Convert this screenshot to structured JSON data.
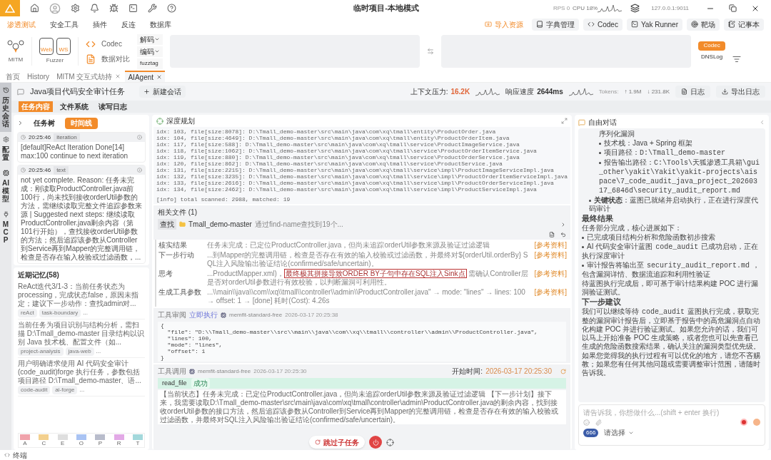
{
  "titlebar": {
    "title": "临时项目-本地模式",
    "rps": "RPS 0",
    "cpu": "CPU 18%",
    "address": "127.0.0.1:9011"
  },
  "menu": [
    {
      "label": "渗透测试",
      "selected": true
    },
    {
      "label": "安全工具",
      "selected": false
    },
    {
      "label": "插件",
      "selected": false
    },
    {
      "label": "反连",
      "selected": false
    },
    {
      "label": "数据库",
      "selected": false
    }
  ],
  "menu_actions": [
    "导入资源",
    "字典管理",
    "Codec",
    "Yak Runner",
    "靶场",
    "记事本"
  ],
  "toolbar": {
    "mitm": "MITM",
    "fuzzer": "Fuzzer",
    "web": "Web",
    "ws": "WS",
    "codec": "Codec",
    "compare": "数据对比",
    "decode": "解码",
    "encode": "编码",
    "fuzztag": "fuzztag",
    "side_buttons": [
      {
        "label": "Codec",
        "selected": true
      },
      {
        "label": "DNSLog",
        "selected": false
      }
    ]
  },
  "page_tabs": [
    {
      "label": "首页",
      "selected": false,
      "closable": false
    },
    {
      "label": "History",
      "selected": false,
      "closable": false
    },
    {
      "label": "MITM 交互式劫持",
      "selected": false,
      "closable": true
    },
    {
      "label": "AIAgent",
      "selected": true,
      "closable": true
    }
  ],
  "side_strip": [
    {
      "label": "历史会话",
      "selected": true
    },
    {
      "label": "配置",
      "selected": false
    },
    {
      "label": "AI模型",
      "selected": false
    },
    {
      "label": "MCP",
      "selected": false
    }
  ],
  "header": {
    "title": "Java项目代码安全审计任务",
    "new_session": "新建会话",
    "pressure_label": "上下文压力:",
    "pressure": "16.2K",
    "speed_label": "响应速度",
    "speed": "2644ms",
    "tokens_label": "Tokens:",
    "tokens_up": "↑ 1.9M",
    "tokens_down": "↓ 231.8K",
    "log": "日志",
    "export": "导出日志"
  },
  "content_tabs": [
    {
      "label": "任务内容",
      "selected": true
    },
    {
      "label": "文件系统",
      "selected": false
    },
    {
      "label": "读写日志",
      "selected": false
    }
  ],
  "left": {
    "view_tabs": [
      {
        "label": "任务树",
        "selected": false
      },
      {
        "label": "时间线",
        "selected": true
      }
    ],
    "events": [
      {
        "time": "20:25:46",
        "tag": "iteration",
        "text": "[default]ReAct Iteration Done[14] max:100 continue to next iteration"
      },
      {
        "time": "20:25:46",
        "tag": "text",
        "text": "not yet complete. Reason: 任务未完成：刚读取ProductController.java前100行，尚未找到接收orderUtil参数的方法，需继续读取完整文件追踪参数来源 | Suggested next steps: 继续读取ProductController.java剩余内容（第101行开始），查找接收orderUtil参数的方法；然后追踪该参数从Controller到Service再到Mapper的完整调用链，检查是否存在输入校验或过滤函数，..."
      }
    ],
    "memory_title": "近期记忆(58)",
    "memories": [
      {
        "text": "ReAct迭代3/1-3：当前任务状态为processing，完成状态false，原因未指定；建议下一步动作：查找admin对...",
        "tags": [
          "reAct",
          "task-boundary"
        ]
      },
      {
        "text": "当前任务为项目识别与结构分析，需扫描 D:\\Tmall_demo-master 目录结构以识别 Java 技术栈、配置文件（如...",
        "tags": [
          "project-analysis",
          "java-web"
        ]
      },
      {
        "text": "用户明确请求使用 AI 代码安全审计 (code_audit)forge 执行任务，参数包括项目路径 D:\\Tmall_demo-master、语...",
        "tags": [
          "code-audit",
          "ai-forge"
        ]
      }
    ],
    "more": "...",
    "legend": [
      {
        "letter": "A",
        "color": "#f0a3ab"
      },
      {
        "letter": "C",
        "color": "#f3d08e"
      },
      {
        "letter": "E",
        "color": "#dedede"
      },
      {
        "letter": "O",
        "color": "#a9c3f3"
      },
      {
        "letter": "P",
        "color": "#b8bccb"
      },
      {
        "letter": "R",
        "color": "#e2a9e6"
      },
      {
        "letter": "T",
        "color": "#a3d8db"
      }
    ]
  },
  "plan": {
    "title": "深度规划",
    "lines": [
      "idx: 103, file[size:8078]: D:\\Tmall_demo-master\\src\\main\\java\\com\\xq\\tmall\\entity\\ProductOrder.java",
      "idx: 104, file[size:4649]: D:\\Tmall_demo-master\\src\\main\\java\\com\\xq\\tmall\\entity\\ProductOrderItem.java",
      "idx: 117, file[size:588]: D:\\Tmall_demo-master\\src\\main\\java\\com\\xq\\tmall\\service\\ProductImageService.java",
      "idx: 118, file[size:1062]: D:\\Tmall_demo-master\\src\\main\\java\\com\\xq\\tmall\\service\\ProductOrderItemService.java",
      "idx: 119, file[size:880]: D:\\Tmall_demo-master\\src\\main\\java\\com\\xq\\tmall\\service\\ProductOrderService.java",
      "idx: 120, file[size:862]: D:\\Tmall_demo-master\\src\\main\\java\\com\\xq\\tmall\\service\\ProductService.java",
      "idx: 131, file[size:2215]: D:\\Tmall_demo-master\\src\\main\\java\\com\\xq\\tmall\\service\\impl\\ProductImageServiceImpl.java",
      "idx: 132, file[size:3235]: D:\\Tmall_demo-master\\src\\main\\java\\com\\xq\\tmall\\service\\impl\\ProductOrderItemServiceImpl.java",
      "idx: 133, file[size:2616]: D:\\Tmall_demo-master\\src\\main\\java\\com\\xq\\tmall\\service\\impl\\ProductOrderServiceImpl.java",
      "idx: 134, file[size:2462]: D:\\Tmall_demo-master\\src\\main\\java\\com\\xq\\tmall\\service\\impl\\ProductServiceImpl.java"
    ],
    "summary": "[info] total scanned: 2988, matched: 19",
    "files_title": "相关文件 (1)",
    "file_action": "查找",
    "file_name": "Tmall_demo-master",
    "file_note": "通过find-name查找到19个..."
  },
  "steps": [
    {
      "label": "核实结果",
      "text": "任务未完成：已定位ProductController.java，但尚未追踪orderUtil参数来源及验证过滤逻辑",
      "ref": "[参考资料]"
    },
    {
      "label": "下一步行动",
      "text": "...到Mapper的完整调用链，检查是否存在有效的输入校验或过滤函数，并最终对${orderUtil.orderBy} SQL注入风险输出验证结论(confirmed/safe/uncertain)。",
      "ref": "[参考资料]"
    },
    {
      "label": "思考",
      "text": "...ProductMapper.xml)，",
      "highlight": "最终极其拼接导致ORDER BY子句中存在SQL注入Sink点",
      "rest": "需确认Controller层是否对orderUtil参数进行有效校验，以判断漏洞可利用性。",
      "ref": "[参考资料]"
    },
    {
      "label": "生成工具参数",
      "text": "...\\\\main\\\\java\\\\com\\\\xq\\\\tmall\\\\controller\\\\admin\\\\ProductController.java\" → mode: \"lines\" → lines: 100 → offset: 1 → [done] 耗时(Cost): 4.26s",
      "ref": "[参考资料]"
    }
  ],
  "review": {
    "title": "工具审阅",
    "action": "立即执行",
    "model": "memfit-standard-free",
    "time": "2026-03-17 20:25:38",
    "code": [
      "{",
      "  \"file\": \"D:\\\\Tmall_demo-master\\\\src\\\\main\\\\java\\\\com\\\\xq\\\\tmall\\\\controller\\\\admin\\\\ProductController.java\",",
      "  \"lines\": 100,",
      "  \"mode\": \"lines\",",
      "  \"offset\": 1",
      "}"
    ]
  },
  "call": {
    "title": "工具调用",
    "model": "memfit-standard-free",
    "time": "2026-03-17 20:25:30",
    "start_label": "开始时间:",
    "start": "2026-03-17 20:25:30",
    "tool": "read_file",
    "status": "成功",
    "text": "【当前状态】任务未完成：已定位ProductController.java，但尚未追踪orderUtil参数来源及验证过滤逻辑 【下一步计划】接下来，我需要读取D:\\Tmall_demo-master\\src\\main\\java\\com\\xq\\tmall\\controller\\admin\\ProductController.java的剩余内容，找到接收orderUtil参数的接口方法，然后追踪该参数从Controller到Service再到Mapper的完整调用链，检查是否存在有效的输入校验或过滤函数，并最终对SQL注入风险输出验证结论(confirmed/safe/uncertain)。"
  },
  "floating": {
    "skip": "跳过子任务"
  },
  "chat": {
    "title": "自由对话",
    "top": "序列化漏洞",
    "sub_items": [
      {
        "text": "技术栈：Java + Spring 框架"
      },
      {
        "text": "项目路径：",
        "code": "D:\\Tmall_demo-master"
      },
      {
        "text": "报告输出路径：",
        "code": "C:\\Tools\\天狐渗透工具箱\\gui_other\\yakit\\Yakit\\yakit-projects\\aispace\\7_code_audit_java_project_20260317_6846d\\security_audit_report.md"
      }
    ],
    "key_state": "**关键状态**：蓝图已就绪并启动执行，正在进行深度代码审计",
    "h_result": "最终结果",
    "result_intro": "任务部分完成，核心进展如下：",
    "results": [
      {
        "text": "已完成项目结构分析和危险函数初步搜索"
      },
      {
        "text": "AI 代码安全审计蓝图",
        "code": "code_audit",
        "after": "已成功启动，正在执行深度审计"
      },
      {
        "text": "审计报告将输出至",
        "code": "security_audit_report.md",
        "after": "，包含漏洞详情、数据流追踪和利用性验证"
      }
    ],
    "result_after": "待蓝图执行完成后，即可基于审计结果构建 POC 进行漏洞验证测试。",
    "h_next": "下一步建议",
    "next": [
      {
        "text": "我们可以继续等待",
        "code": "code_audit",
        "after": "蓝图执行完成，获取完整的漏洞审计报告后，立即基于报告中的高危漏洞点自动化构建 POC 并进行验证测试。如果您允许的话，我们可以马上开始准备 POC 生成策略，或者您也可以先查看已生成的危险函数搜索结果，确认关注的漏洞类型优先级。"
      },
      {
        "text": "如果您觉得我的执行过程有可以优化的地方，请您不吝赐教；如果您有任何其他问题或需要调整审计范围，请随时告诉我。"
      }
    ],
    "placeholder": "请告诉我，你想做什么...(shift + enter 换行)",
    "badge": "666",
    "select": "请选择"
  },
  "status": {
    "terminal": "终端"
  }
}
